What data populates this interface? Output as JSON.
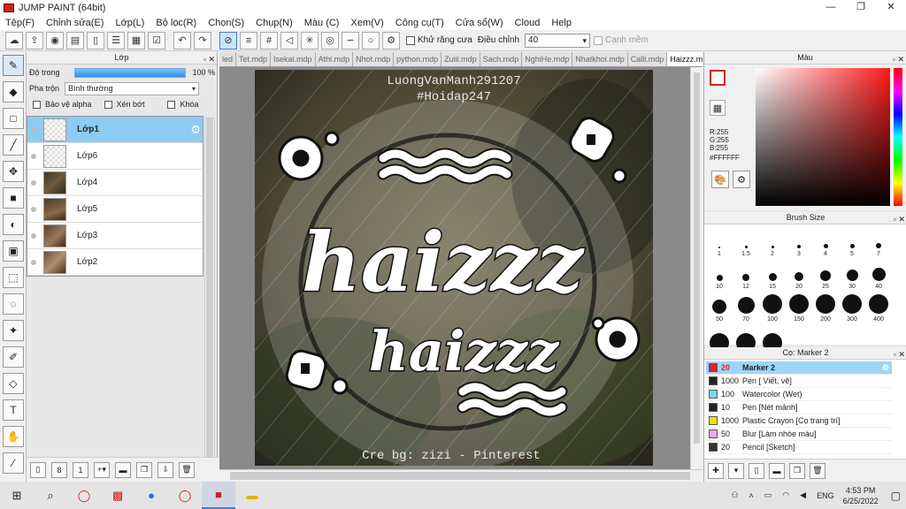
{
  "window": {
    "title": "JUMP PAINT (64bit)",
    "buttons": [
      "—",
      "❐",
      "✕"
    ]
  },
  "menu": [
    "Tệp(F)",
    "Chỉnh sửa(E)",
    "Lớp(L)",
    "Bộ lọc(R)",
    "Chọn(S)",
    "Chụp(N)",
    "Màu (C)",
    "Xem(V)",
    "Công cụ(T)",
    "Cửa sổ(W)",
    "Cloud",
    "Help"
  ],
  "toolbar": {
    "antialias_label": "Khử răng cưa",
    "adjust_label": "Điều chỉnh",
    "adjust_value": "40",
    "smooth_label": "Cạnh mềm"
  },
  "layer_panel": {
    "title": "Lớp",
    "opacity_label": "Độ trong",
    "opacity_value": "100 %",
    "blend_label": "Pha trộn",
    "blend_value": "Bình thường",
    "protect_alpha": "Bảo vệ alpha",
    "clipping": "Xén bớt",
    "lock": "Khóa",
    "layers": [
      {
        "name": "Lớp1",
        "selected": true
      },
      {
        "name": "Lớp6"
      },
      {
        "name": "Lớp4"
      },
      {
        "name": "Lớp5"
      },
      {
        "name": "Lớp3"
      },
      {
        "name": "Lớp2"
      }
    ]
  },
  "canvas": {
    "tabs": [
      "led",
      "Tet.mdp",
      "Isekai.mdp",
      "Athi.mdp",
      "Nhot.mdp",
      "python.mdp",
      "Zuiii.mdp",
      "Sach.mdp",
      "NghiHe.mdp",
      "Nhatkhoi.mdp",
      "Calli.mdp",
      "Haizzz.mdp"
    ],
    "active_tab": "Haizzz.mdp",
    "artwork": {
      "top_line1": "LuongVanManh291207",
      "top_line2": "#Hoidap247",
      "word1": "haizzz",
      "word2": "haizzz",
      "credit": "Cre bg: zizi - Pinterest"
    }
  },
  "color_panel": {
    "title": "Màu",
    "r": "R:255",
    "g": "G:255",
    "b": "B:255",
    "hex": "#FFFFFF",
    "main_swatch": "#ffffff",
    "accent": "#e02020"
  },
  "brush_panel": {
    "title": "Brush Size",
    "sizes": [
      "1",
      "1.5",
      "2",
      "3",
      "4",
      "5",
      "7",
      "10",
      "12",
      "15",
      "20",
      "25",
      "30",
      "40",
      "50",
      "70",
      "100",
      "150",
      "200",
      "300",
      "400",
      "",
      "",
      ""
    ]
  },
  "sub_panel": {
    "title": "Cọ: Marker 2",
    "items": [
      {
        "size": "20",
        "name": "Marker 2",
        "color": "#e02030",
        "selected": true
      },
      {
        "size": "1000",
        "name": "Pen [ Viết, vẽ]",
        "color": "#222222"
      },
      {
        "size": "100",
        "name": "Watercolor (Wet)",
        "color": "#6fd8ef"
      },
      {
        "size": "10",
        "name": "Pen [Nét mảnh]",
        "color": "#222222"
      },
      {
        "size": "1000",
        "name": "Plastic Crayon [Cọ trang trí]",
        "color": "#f2e000"
      },
      {
        "size": "50",
        "name": "Blur [Làm nhòe màu]",
        "color": "#f4a6e6"
      },
      {
        "size": "20",
        "name": "Pencil [Sketch]",
        "color": "#333333"
      }
    ]
  },
  "taskbar": {
    "time": "4:53 PM",
    "date": "6/25/2022",
    "lang": "ENG"
  }
}
